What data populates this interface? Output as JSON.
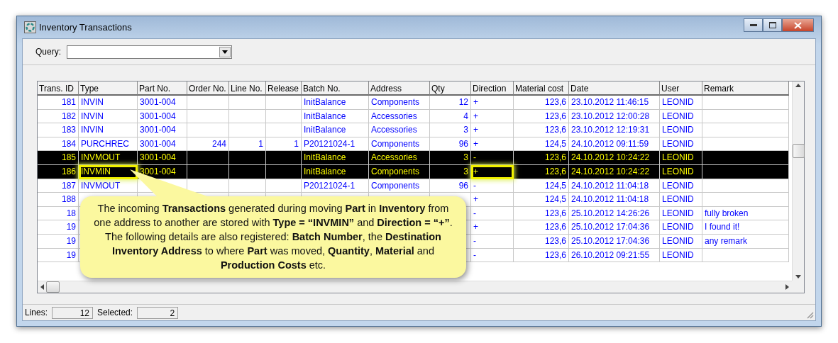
{
  "window": {
    "title": "Inventory Transactions"
  },
  "query": {
    "label": "Query:"
  },
  "table": {
    "columns": [
      {
        "label": "Trans. ID",
        "kind": "number"
      },
      {
        "label": "Type",
        "kind": "text"
      },
      {
        "label": "Part No.",
        "kind": "text"
      },
      {
        "label": "Order No.",
        "kind": "number"
      },
      {
        "label": "Line No.",
        "kind": "number"
      },
      {
        "label": "Release",
        "kind": "number"
      },
      {
        "label": "Batch No.",
        "kind": "text"
      },
      {
        "label": "Address",
        "kind": "text"
      },
      {
        "label": "Qty",
        "kind": "number"
      },
      {
        "label": "Direction",
        "kind": "text"
      },
      {
        "label": "Material cost",
        "kind": "number"
      },
      {
        "label": "Date",
        "kind": "text"
      },
      {
        "label": "User",
        "kind": "text"
      },
      {
        "label": "Remark",
        "kind": "text"
      }
    ],
    "rows": [
      {
        "selected": false,
        "cells": [
          "181",
          "INVIN",
          "3001-004",
          null,
          null,
          null,
          "InitBalance",
          "Components",
          "12",
          "+",
          "123,6",
          "23.10.2012 11:46:15",
          "LEONID",
          null
        ]
      },
      {
        "selected": false,
        "cells": [
          "182",
          "INVIN",
          "3001-004",
          null,
          null,
          null,
          "InitBalance",
          "Accessories",
          "4",
          "+",
          "123,6",
          "23.10.2012 12:00:28",
          "LEONID",
          null
        ]
      },
      {
        "selected": false,
        "cells": [
          "183",
          "INVIN",
          "3001-004",
          null,
          null,
          null,
          "InitBalance",
          "Accessories",
          "3",
          "+",
          "123,6",
          "23.10.2012 12:19:31",
          "LEONID",
          null
        ]
      },
      {
        "selected": false,
        "cells": [
          "184",
          "PURCHREC",
          "3001-004",
          "244",
          "1",
          "1",
          "P20121024-1",
          "Components",
          "96",
          "+",
          "124,5",
          "24.10.2012 09:11:59",
          "LEONID",
          null
        ]
      },
      {
        "selected": true,
        "cells": [
          "185",
          "INVMOUT",
          "3001-004",
          null,
          null,
          null,
          "InitBalance",
          "Accessories",
          "3",
          "-",
          "123,6",
          "24.10.2012 10:24:22",
          "LEONID",
          null
        ]
      },
      {
        "selected": true,
        "cells": [
          "186",
          {
            "text": "INVMIN",
            "highlighted": true
          },
          "3001-004",
          null,
          null,
          null,
          "InitBalance",
          "Components",
          "3",
          {
            "text": "+",
            "highlighted": true
          },
          "123,6",
          "24.10.2012 10:24:22",
          "LEONID",
          null
        ]
      },
      {
        "selected": false,
        "cells": [
          "187",
          "INVMOUT",
          null,
          null,
          null,
          null,
          "P20121024-1",
          "Components",
          "96",
          "-",
          "124,5",
          "24.10.2012 11:04:18",
          "LEONID",
          null
        ]
      },
      {
        "selected": false,
        "cells": [
          "188",
          null,
          null,
          null,
          null,
          null,
          null,
          null,
          null,
          "+",
          "124,5",
          "24.10.2012 11:04:18",
          "LEONID",
          null
        ]
      },
      {
        "selected": false,
        "cells": [
          "18",
          null,
          null,
          null,
          null,
          null,
          null,
          null,
          null,
          "-",
          "123,6",
          "25.10.2012 14:26:26",
          "LEONID",
          "fully broken"
        ]
      },
      {
        "selected": false,
        "cells": [
          "19",
          null,
          null,
          null,
          null,
          null,
          null,
          null,
          null,
          "+",
          "123,6",
          "25.10.2012 17:04:36",
          "LEONID",
          "I found it!"
        ]
      },
      {
        "selected": false,
        "cells": [
          "19",
          null,
          null,
          null,
          null,
          null,
          null,
          null,
          null,
          "-",
          "123,6",
          "25.10.2012 17:04:36",
          "LEONID",
          "any remark"
        ]
      },
      {
        "selected": false,
        "cells": [
          "19",
          null,
          null,
          null,
          null,
          null,
          null,
          null,
          null,
          "-",
          "123,6",
          "26.10.2012 09:21:55",
          "LEONID",
          null
        ]
      }
    ]
  },
  "callout": {
    "text": "The incoming **Transactions** generated during moving **Part** in **Inventory** from one address to another are stored with **Type = “INVMIN”** and **Direction = “+”**. The following details are also registered: **Batch Number**, the **Destination Inventory Address** to where **Part** was moved, **Quantity**, **Material** and **Production Costs** etc."
  },
  "status_bar": {
    "lines_label": "Lines:",
    "lines": "12",
    "selected_label": "Selected:",
    "selected": "2"
  }
}
